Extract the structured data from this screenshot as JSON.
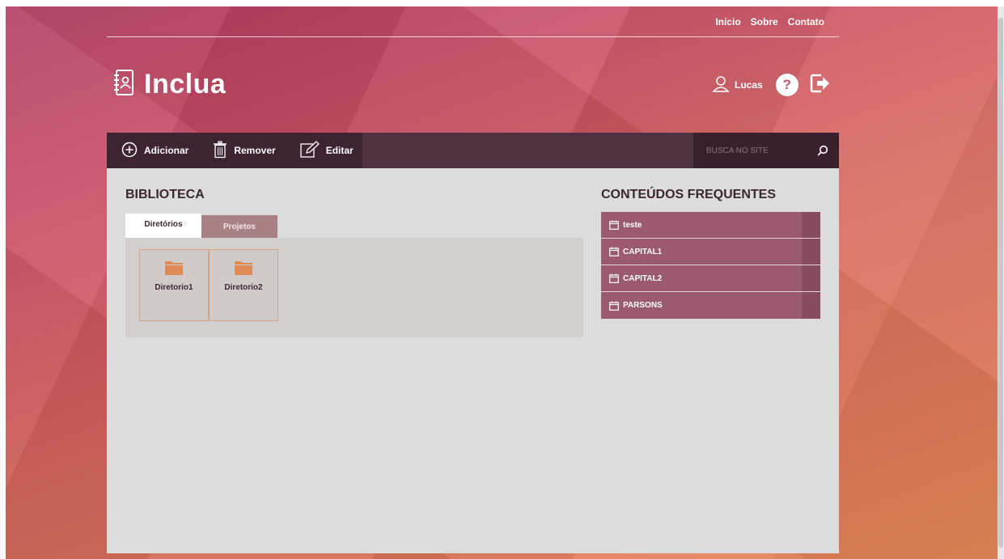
{
  "nav": {
    "links": [
      "Início",
      "Sobre",
      "Contato"
    ]
  },
  "brand": {
    "name": "Inclua"
  },
  "user": {
    "name": "Lucas",
    "help_label": "?"
  },
  "toolbar": {
    "add_label": "Adicionar",
    "remove_label": "Remover",
    "edit_label": "Editar",
    "search_placeholder": "BUSCA NO SITE"
  },
  "library": {
    "title": "BIBLIOTECA",
    "tabs": [
      "Diretórios",
      "Projetos"
    ],
    "active_tab": "Diretórios",
    "folders": [
      "Diretorio1",
      "Diretorio2"
    ]
  },
  "frequent": {
    "title": "CONTEÚDOS FREQUENTES",
    "items": [
      "teste",
      "CAPITAL1",
      "CAPITAL2",
      "PARSONS"
    ]
  },
  "colors": {
    "toolbar": "#4e3240",
    "toolbar_buttons": "#3e2330",
    "list_item": "#9b5a70",
    "folder_icon": "#e08a55",
    "panel": "#dcdcdc"
  }
}
